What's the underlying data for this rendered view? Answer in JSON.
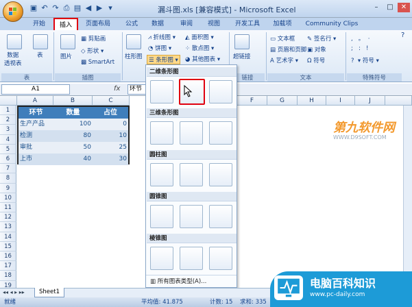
{
  "window": {
    "title": "漏斗图.xls [兼容模式] - Microsoft Excel"
  },
  "tabs": [
    "开始",
    "插入",
    "页面布局",
    "公式",
    "数据",
    "审阅",
    "视图",
    "开发工具",
    "加载项",
    "Community Clips"
  ],
  "ribbon": {
    "tables": {
      "label": "表",
      "pivot": "数据\n透视表",
      "table": "表"
    },
    "illustrations": {
      "label": "插图",
      "picture": "图片",
      "clipart": "剪贴画",
      "shapes": "形状",
      "smartart": "SmartArt"
    },
    "charts": {
      "column": "柱形图",
      "line": "折线图",
      "pie": "饼图",
      "bar": "条形图",
      "area": "面积图",
      "scatter": "散点图",
      "other": "其他图表"
    },
    "links": {
      "label": "链接",
      "hyperlink": "超链接"
    },
    "text": {
      "label": "文本",
      "textbox": "文本框",
      "header_footer": "页眉和页脚",
      "wordart": "艺术字",
      "signature": "签名行",
      "object": "对象",
      "symbol": "符号"
    },
    "special": {
      "label": "特殊符号",
      "symbol": "符号"
    }
  },
  "formula_bar": {
    "namebox": "A1",
    "fx": "fx",
    "content": "环节"
  },
  "columns": [
    "A",
    "B",
    "C",
    "D",
    "E",
    "F",
    "G",
    "H",
    "I",
    "J"
  ],
  "rows": [
    "1",
    "2",
    "3",
    "4",
    "5",
    "6",
    "7",
    "8",
    "9",
    "10",
    "11",
    "12",
    "13",
    "14",
    "15",
    "16",
    "17",
    "18",
    "19"
  ],
  "table": {
    "headers": [
      "环节",
      "数量",
      "占位"
    ],
    "data": [
      [
        "生产产品",
        "100",
        "0"
      ],
      [
        "检测",
        "80",
        "10"
      ],
      [
        "审批",
        "50",
        "25"
      ],
      [
        "上市",
        "40",
        "30"
      ]
    ]
  },
  "dropdown": {
    "sections": [
      "二维条形图",
      "三维条形图",
      "圆柱图",
      "圆锥图",
      "棱锥图"
    ],
    "all_types": "所有图表类型(A)..."
  },
  "sheet": {
    "tab": "Sheet1"
  },
  "status": {
    "ready": "就绪",
    "average": "平均值: 41.875",
    "count": "计数: 15",
    "sum": "求和: 335"
  },
  "watermarks": {
    "top": "第九软件网",
    "top_url": "WWW.D9SOFT.COM",
    "brand": "电脑百科知识",
    "brand_url": "www.pc-daily.com"
  }
}
